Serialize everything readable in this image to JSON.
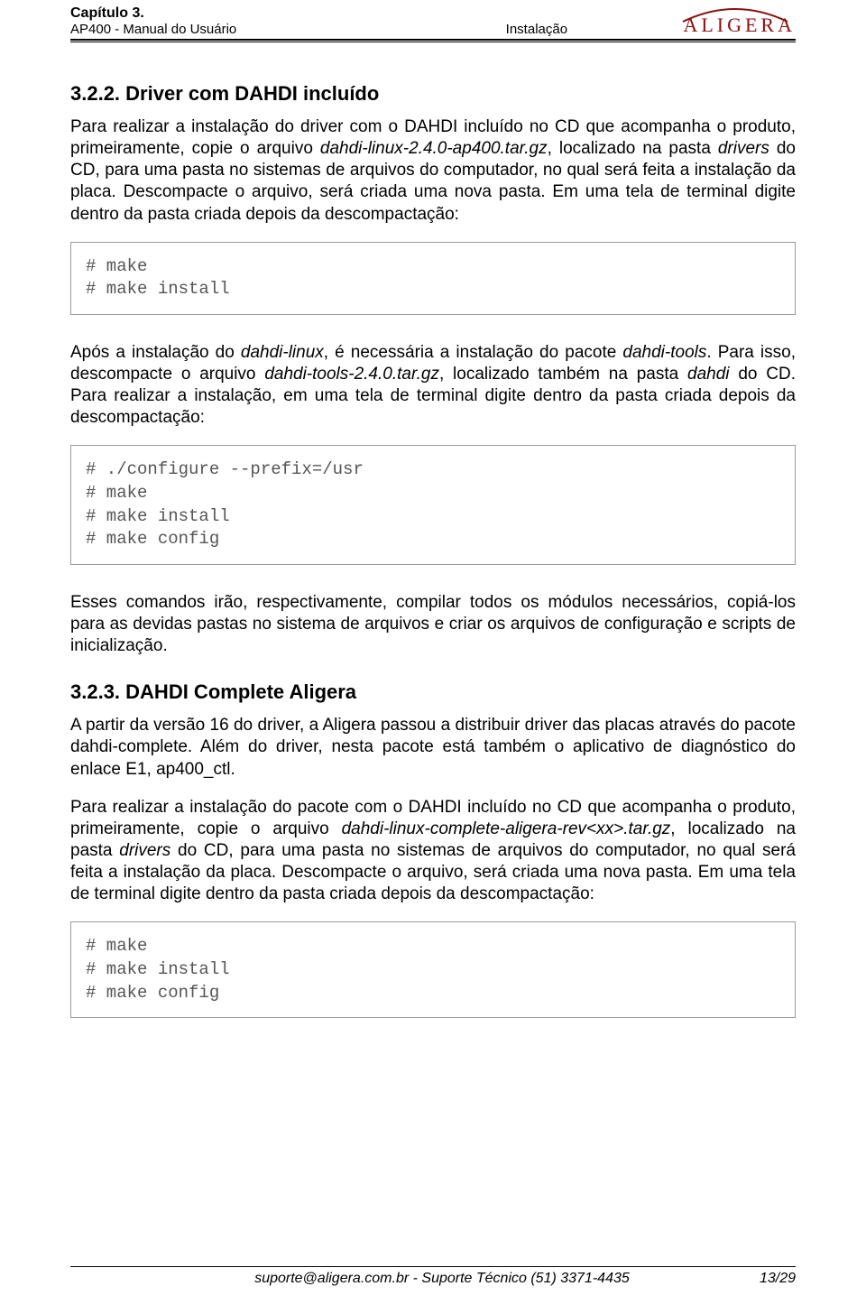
{
  "header": {
    "chapter": "Capítulo 3.",
    "manual": "AP400 - Manual do Usuário",
    "section_center": "Instalação",
    "brand": "ALIGERA"
  },
  "sec1": {
    "heading": "3.2.2. Driver com DAHDI incluído",
    "p1a": "Para realizar a instalação do driver com o DAHDI incluído no CD que acompanha o produto, primeiramente, copie o arquivo ",
    "p1_file": "dahdi-linux-2.4.0-ap400.tar.gz",
    "p1b": ", localizado na pasta ",
    "p1_dir": "drivers",
    "p1c": " do CD, para uma pasta no sistemas de arquivos do computador, no qual será feita a instalação da placa. Descompacte o arquivo, será criada uma nova pasta. Em uma tela de terminal digite dentro da pasta criada depois da descompactação:",
    "code1": "# make\n# make install",
    "p2a": "Após a instalação do ",
    "p2_pkg1": "dahdi-linux",
    "p2b": ", é necessária a instalação do pacote ",
    "p2_pkg2": "dahdi-tools",
    "p2c": ". Para isso, descompacte o arquivo ",
    "p2_file": "dahdi-tools-2.4.0.tar.gz",
    "p2d": ", localizado também na pasta ",
    "p2_dir": "dahdi",
    "p2e": " do CD. Para realizar a instalação, em uma tela de terminal digite dentro da pasta criada depois da descompactação:",
    "code2": "# ./configure --prefix=/usr\n# make\n# make install\n# make config",
    "p3": "Esses comandos irão, respectivamente, compilar todos os módulos necessários, copiá-los para as devidas pastas no sistema de arquivos e criar os arquivos de configuração e scripts de inicialização."
  },
  "sec2": {
    "heading": "3.2.3. DAHDI Complete Aligera",
    "p1": "A partir da versão 16 do driver, a Aligera passou a distribuir driver das placas através do pacote dahdi-complete. Além do driver, nesta pacote está também o aplicativo de diagnóstico do enlace E1, ap400_ctl.",
    "p2a": "Para realizar a instalação do pacote com o DAHDI incluído no CD que acompanha o produto, primeiramente, copie o arquivo ",
    "p2_file": "dahdi-linux-complete-aligera-rev<xx>.tar.gz",
    "p2b": ", localizado na pasta ",
    "p2_dir": "drivers",
    "p2c": " do CD, para uma pasta no sistemas de arquivos do computador, no qual será feita a instalação da placa. Descompacte o arquivo, será criada uma nova pasta. Em uma tela de terminal digite dentro da pasta criada depois da descompactação:",
    "code1": "# make\n# make install\n# make config"
  },
  "footer": {
    "center": "suporte@aligera.com.br - Suporte Técnico (51) 3371-4435",
    "page": "13/29"
  }
}
